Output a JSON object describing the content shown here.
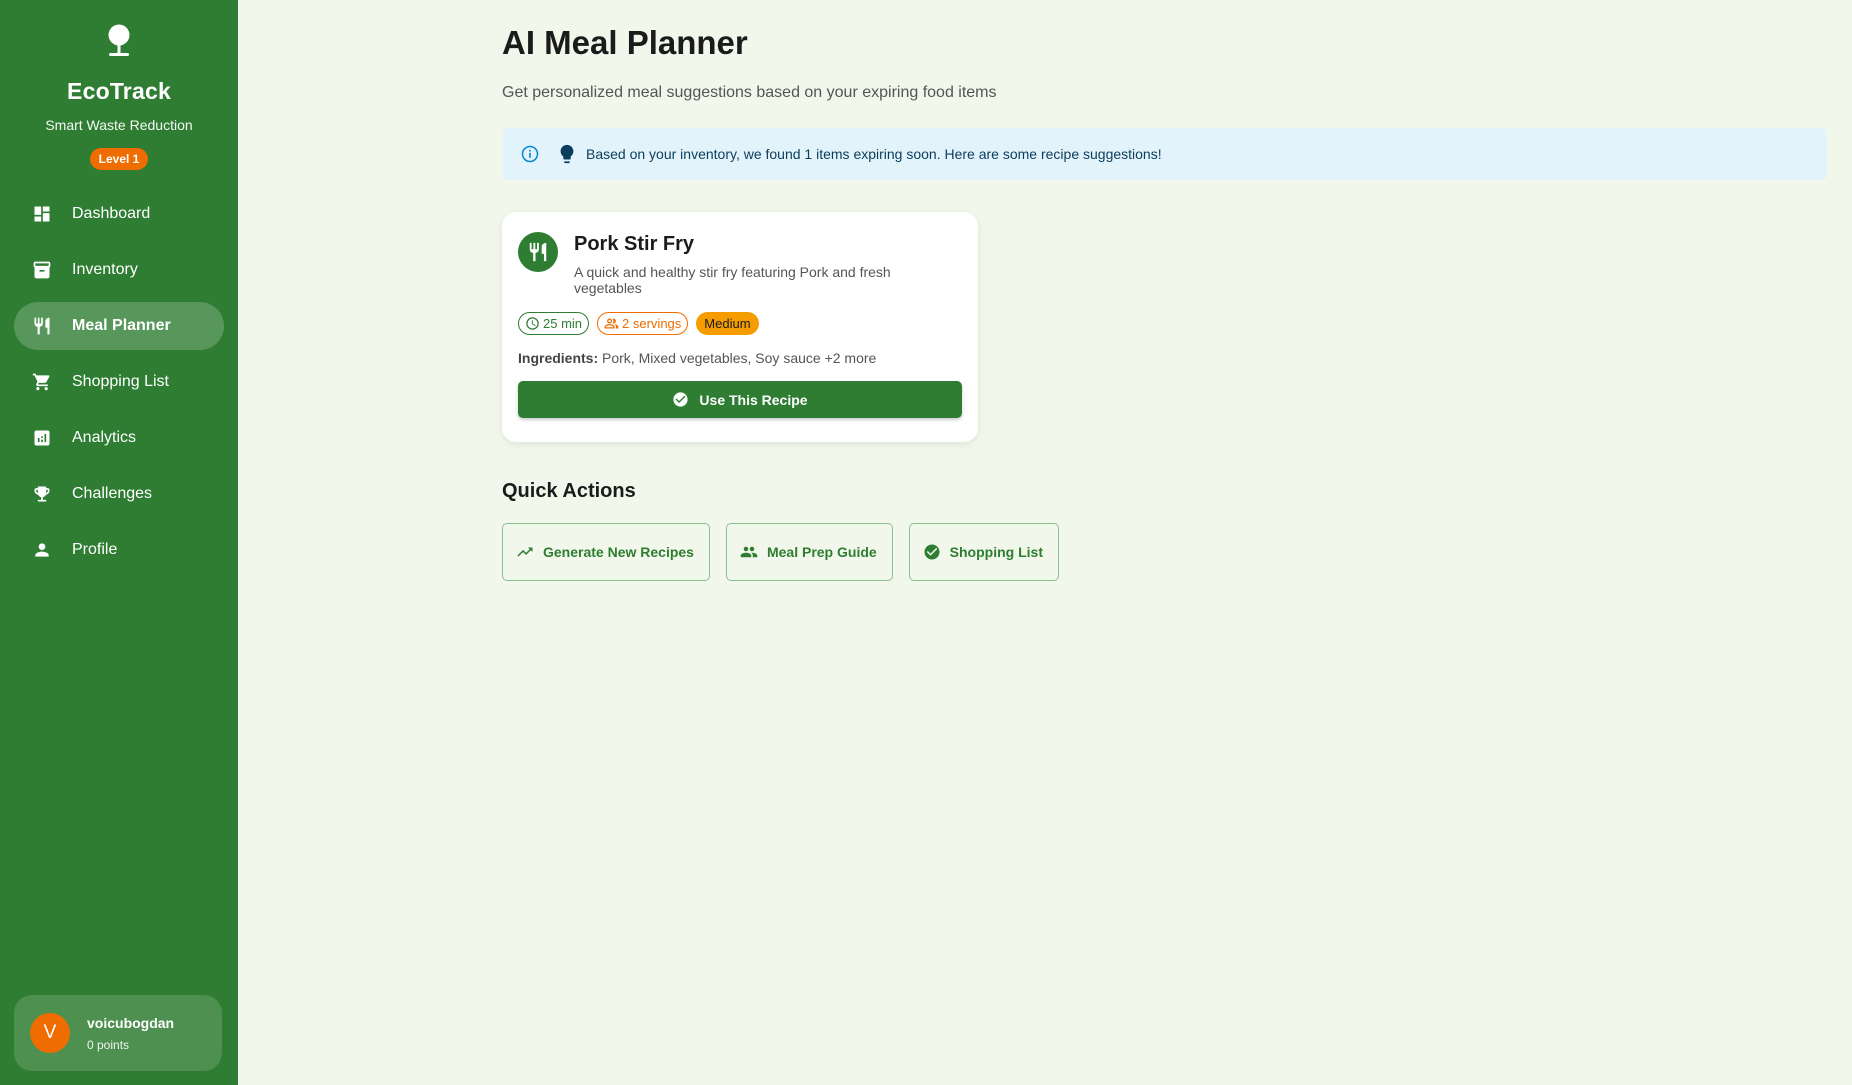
{
  "sidebar": {
    "brand_name": "EcoTrack",
    "brand_sub": "Smart Waste Reduction",
    "level": "Level 1",
    "items": [
      {
        "label": "Dashboard",
        "icon": "dashboard-icon"
      },
      {
        "label": "Inventory",
        "icon": "inventory-icon"
      },
      {
        "label": "Meal Planner",
        "icon": "restaurant-icon",
        "active": true
      },
      {
        "label": "Shopping List",
        "icon": "cart-icon"
      },
      {
        "label": "Analytics",
        "icon": "analytics-icon"
      },
      {
        "label": "Challenges",
        "icon": "trophy-icon"
      },
      {
        "label": "Profile",
        "icon": "person-icon"
      }
    ],
    "user": {
      "initial": "V",
      "name": "voicubogdan",
      "points": "0 points"
    }
  },
  "main": {
    "title": "AI Meal Planner",
    "subtitle": "Get personalized meal suggestions based on your expiring food items",
    "banner": "Based on your inventory, we found 1 items expiring soon. Here are some recipe suggestions!",
    "recipe": {
      "title": "Pork Stir Fry",
      "description": "A quick and healthy stir fry featuring Pork and fresh vegetables",
      "time": "25 min",
      "servings": "2 servings",
      "difficulty": "Medium",
      "ingredients_label": "Ingredients:",
      "ingredients": "Pork, Mixed vegetables, Soy sauce +2 more",
      "button": "Use This Recipe"
    },
    "quick_actions": {
      "title": "Quick Actions",
      "buttons": [
        "Generate New Recipes",
        "Meal Prep Guide",
        "Shopping List"
      ]
    }
  },
  "colors": {
    "primary": "#2e7d32",
    "accent": "#ef6c00",
    "background": "#f1f7ea",
    "banner": "#e3f3fc",
    "difficulty": "#f59c00"
  }
}
